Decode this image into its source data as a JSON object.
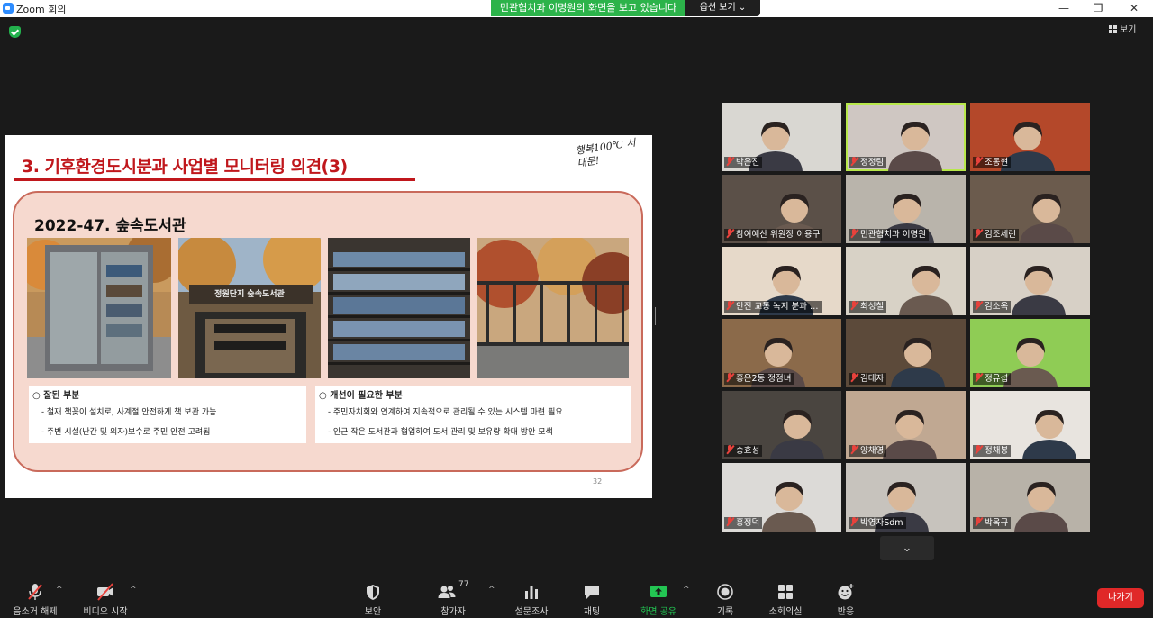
{
  "window": {
    "title": "Zoom 회의",
    "minimize": "—",
    "maximize": "❐",
    "close": "✕"
  },
  "share_banner": "민관협치과 이명원의 화면을 보고 있습니다",
  "view_options": "옵션 보기 ⌄",
  "view_button": "보기",
  "slide": {
    "title": "3. 기후환경도시분과 사업별 모니터링 의견(3)",
    "slogan": "행복100℃ 서대문!",
    "heading": "2022-47. 숲속도서관",
    "photo_sign": "정원단지 숲속도서관",
    "good_title": "○ 잘된 부분",
    "good_items": [
      "- 철재 책꽂이 설치로, 사계절 안전하게 책 보관 가능",
      "- 주변 시설(난간 및 의자)보수로 주민 안전 고려됨"
    ],
    "improve_title": "○ 개선이 필요한 부분",
    "improve_items": [
      "- 주민자치회와 연계하여 지속적으로 관리될 수 있는 시스템 마련 필요",
      "- 인근 작은 도서관과 협업하여 도서 관리 및 보유량 확대 방안 모색"
    ],
    "page": "32"
  },
  "participants": [
    {
      "name": "박은진",
      "bg": "#d9d7d2"
    },
    {
      "name": "정정림",
      "bg": "#cfc7c2"
    },
    {
      "name": "조동현",
      "bg": "#b4482a"
    },
    {
      "name": "참여예산 위원장 이용구",
      "bg": "#5b5048"
    },
    {
      "name": "민관협치과 이명원",
      "bg": "#b9b4ab"
    },
    {
      "name": "김조세린",
      "bg": "#6b5b4d"
    },
    {
      "name": "안전 교통 녹지 분과 …",
      "bg": "#e6d9c9"
    },
    {
      "name": "최성철",
      "bg": "#d8d2c6"
    },
    {
      "name": "김소옥",
      "bg": "#d7d0c6"
    },
    {
      "name": "홍은2동 정점녀",
      "bg": "#8b6a4a"
    },
    {
      "name": "김태자",
      "bg": "#5c4a3a"
    },
    {
      "name": "정유섭",
      "bg": "#8fcc55"
    },
    {
      "name": "송효성",
      "bg": "#4a4540"
    },
    {
      "name": "양채영",
      "bg": "#c0a892"
    },
    {
      "name": "정채봉",
      "bg": "#e8e4df"
    },
    {
      "name": "홍정덕",
      "bg": "#dcdad7"
    },
    {
      "name": "박영자Sdm",
      "bg": "#c7c3bd"
    },
    {
      "name": "박옥규",
      "bg": "#b8b2a8"
    }
  ],
  "scroll_down": "⌄",
  "toolbar": {
    "mute": "음소거 해제",
    "video": "비디오 시작",
    "security": "보안",
    "participants": "참가자",
    "participant_count": "77",
    "polls": "설문조사",
    "chat": "채팅",
    "share": "화면 공유",
    "record": "기록",
    "breakout": "소회의실",
    "reactions": "반응",
    "leave": "나가기"
  },
  "colors": {
    "accent_green": "#2cb34a",
    "title_red": "#c0171c",
    "panel_bg": "#f6d9cf",
    "leave_red": "#e02828"
  }
}
